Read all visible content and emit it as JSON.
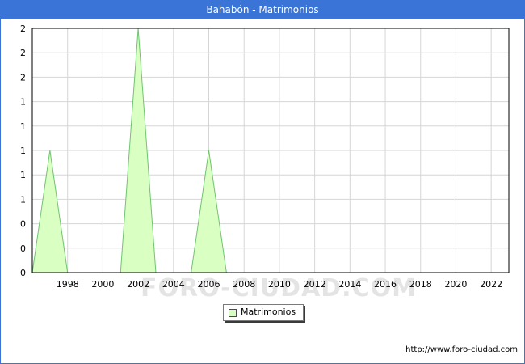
{
  "title": "Bahabón - Matrimonios",
  "url": "http://www.foro-ciudad.com",
  "watermark": "FORO-CIUDAD.COM",
  "colors": {
    "titlebar": "#3a74d6",
    "fill": "#d9ffc2",
    "line": "#6fc56f",
    "grid": "#d6d6d6"
  },
  "chart_data": {
    "type": "area",
    "legend": "Matrimonios",
    "legend_position": "bottom-center",
    "grid": true,
    "x": [
      1996,
      1997,
      1998,
      1999,
      2000,
      2001,
      2002,
      2003,
      2004,
      2005,
      2006,
      2007,
      2008,
      2009,
      2010,
      2011,
      2012,
      2013,
      2014,
      2015,
      2016,
      2017,
      2018,
      2019,
      2020,
      2021,
      2022
    ],
    "values": [
      0,
      1,
      0,
      0,
      0,
      0,
      2,
      0,
      0,
      0,
      1,
      0,
      0,
      0,
      0,
      0,
      0,
      0,
      0,
      0,
      0,
      0,
      0,
      0,
      0,
      0,
      0
    ],
    "xlim": [
      1996,
      2023
    ],
    "ylim": [
      0,
      2
    ],
    "x_ticks": [
      "1998",
      "2000",
      "2002",
      "2004",
      "2006",
      "2008",
      "2010",
      "2012",
      "2014",
      "2016",
      "2018",
      "2020",
      "2022"
    ],
    "y_ticks": [
      "0",
      "0",
      "0",
      "1",
      "1",
      "1",
      "1",
      "1",
      "2",
      "2",
      "2"
    ]
  }
}
